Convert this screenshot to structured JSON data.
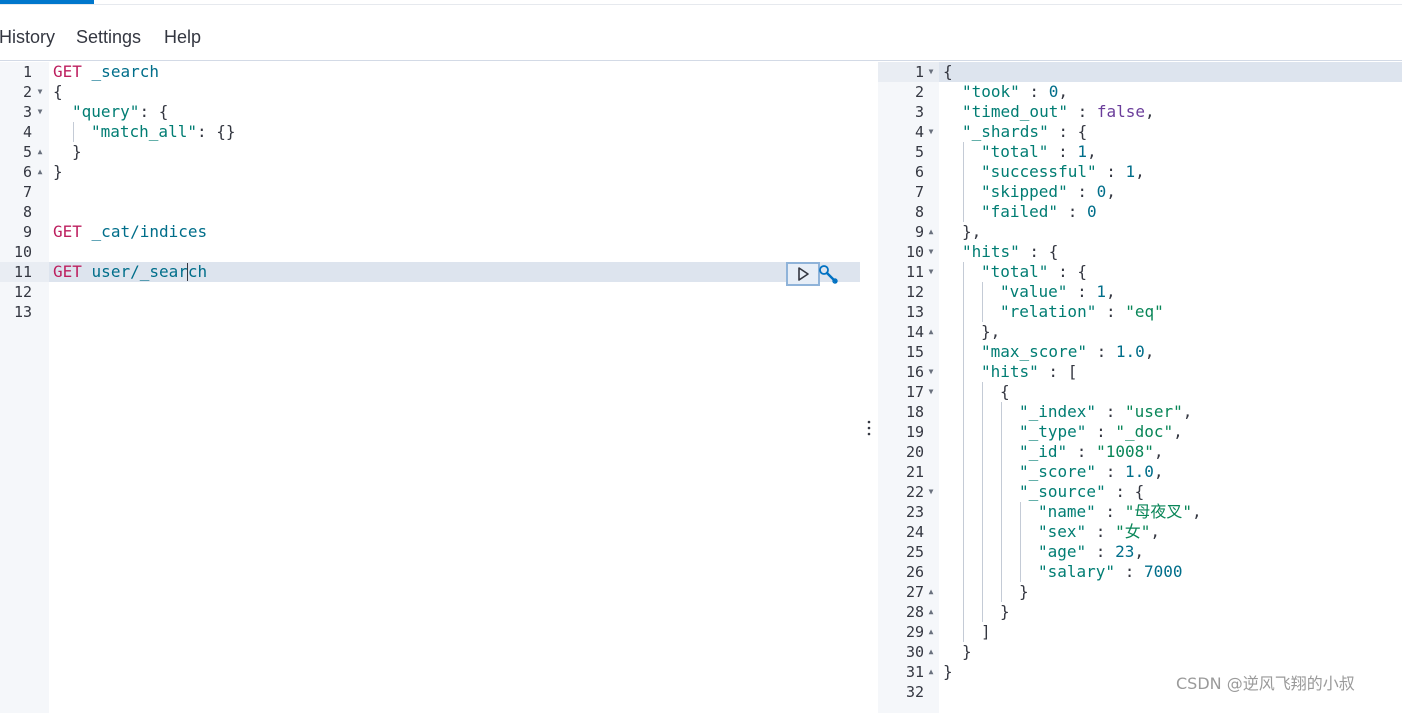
{
  "menu": {
    "history": "History",
    "settings": "Settings",
    "help": "Help"
  },
  "request_editor": {
    "line_numbers": [
      "1",
      "2",
      "3",
      "4",
      "5",
      "6",
      "7",
      "8",
      "9",
      "10",
      "11",
      "12",
      "13"
    ],
    "lines": {
      "l1_method": "GET",
      "l1_url": "_search",
      "l2": "{",
      "l3_key": "\"query\"",
      "l3_rest": ": {",
      "l4_key": "\"match_all\"",
      "l4_rest": ": {}",
      "l5": "}",
      "l6": "}",
      "l9_method": "GET",
      "l9_url": "_cat/indices",
      "l11_method": "GET",
      "l11_url": "user/_search"
    }
  },
  "response_editor": {
    "line_numbers": [
      "1",
      "2",
      "3",
      "4",
      "5",
      "6",
      "7",
      "8",
      "9",
      "10",
      "11",
      "12",
      "13",
      "14",
      "15",
      "16",
      "17",
      "18",
      "19",
      "20",
      "21",
      "22",
      "23",
      "24",
      "25",
      "26",
      "27",
      "28",
      "29",
      "30",
      "31",
      "32"
    ],
    "lines": {
      "l1": "{",
      "l2_key": "\"took\"",
      "l2_val": "0",
      "l3_key": "\"timed_out\"",
      "l3_val": "false",
      "l4_key": "\"_shards\"",
      "l4_rest": " : {",
      "l5_key": "\"total\"",
      "l5_val": "1",
      "l6_key": "\"successful\"",
      "l6_val": "1",
      "l7_key": "\"skipped\"",
      "l7_val": "0",
      "l8_key": "\"failed\"",
      "l8_val": "0",
      "l9": "},",
      "l10_key": "\"hits\"",
      "l10_rest": " : {",
      "l11_key": "\"total\"",
      "l11_rest": " : {",
      "l12_key": "\"value\"",
      "l12_val": "1",
      "l13_key": "\"relation\"",
      "l13_val": "\"eq\"",
      "l14": "},",
      "l15_key": "\"max_score\"",
      "l15_val": "1.0",
      "l16_key": "\"hits\"",
      "l16_rest": " : [",
      "l17": "{",
      "l18_key": "\"_index\"",
      "l18_val": "\"user\"",
      "l19_key": "\"_type\"",
      "l19_val": "\"_doc\"",
      "l20_key": "\"_id\"",
      "l20_val": "\"1008\"",
      "l21_key": "\"_score\"",
      "l21_val": "1.0",
      "l22_key": "\"_source\"",
      "l22_rest": " : {",
      "l23_key": "\"name\"",
      "l23_val": "\"母夜叉\"",
      "l24_key": "\"sex\"",
      "l24_val": "\"女\"",
      "l25_key": "\"age\"",
      "l25_val": "23",
      "l26_key": "\"salary\"",
      "l26_val": "7000",
      "l27": "}",
      "l28": "}",
      "l29": "]",
      "l30": "}",
      "l31": "}"
    }
  },
  "watermark": "CSDN @逆风飞翔的小叔",
  "icons": {
    "run": "play-triangle-icon",
    "settings": "wrench-icon",
    "resize": "vertical-dots-icon"
  },
  "colors": {
    "accent": "#0077cc",
    "method": "#bd1f5f",
    "key": "#017d73",
    "string": "#098658",
    "number": "#006e8a",
    "boolean": "#6a3d9a"
  }
}
